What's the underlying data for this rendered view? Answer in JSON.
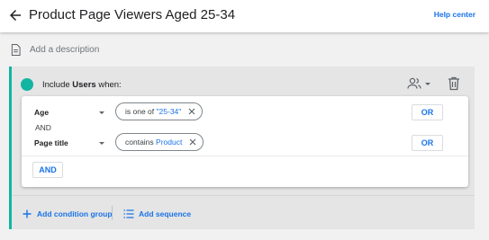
{
  "header": {
    "title": "Product Page Viewers Aged 25-34",
    "help_link": "Help center",
    "back_icon": "arrow-back-icon"
  },
  "description": {
    "placeholder": "Add a description",
    "icon": "document-icon"
  },
  "condition_group": {
    "accent_color": "#12b5a1",
    "include_prefix": "Include",
    "scope": "Users",
    "include_suffix": "when:",
    "scope_icon": "people-icon",
    "delete_icon": "trash-icon",
    "conditions": [
      {
        "dimension": "Age",
        "operator": "is one of",
        "value": "\"25-34\"",
        "or_label": "OR"
      },
      {
        "dimension": "Page title",
        "operator": "contains",
        "value": "Product",
        "or_label": "OR"
      }
    ],
    "and_join": "AND",
    "and_button": "AND"
  },
  "footer": {
    "add_condition_group": "Add condition group",
    "add_sequence": "Add sequence"
  },
  "colors": {
    "link_blue": "#1a73e8",
    "teal": "#12b5a1"
  }
}
